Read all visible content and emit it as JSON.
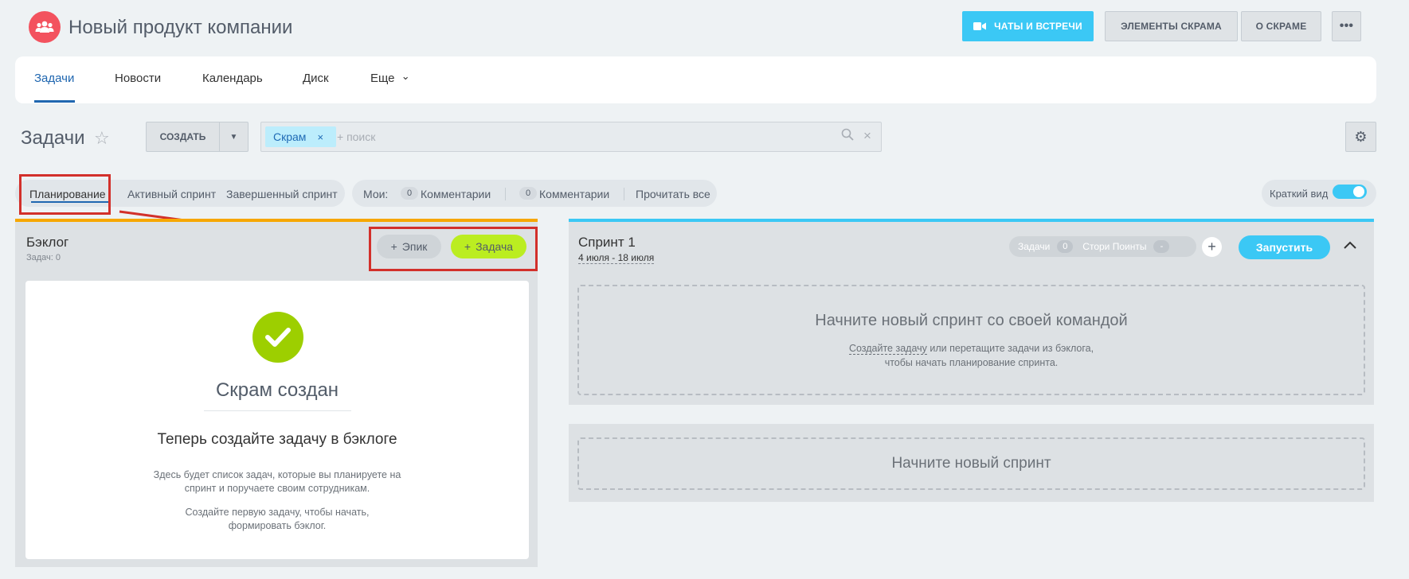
{
  "header": {
    "title": "Новый продукт компании",
    "buttons": {
      "chats": "ЧАТЫ И ВСТРЕЧИ",
      "elements": "ЭЛЕМЕНТЫ СКРАМА",
      "about": "О СКРАМЕ",
      "more": "•••"
    }
  },
  "nav": {
    "tabs": [
      {
        "label": "Задачи",
        "active": true
      },
      {
        "label": "Новости"
      },
      {
        "label": "Календарь"
      },
      {
        "label": "Диск"
      },
      {
        "label": "Еще"
      }
    ],
    "more_chevron": "⌄"
  },
  "toolbar": {
    "title": "Задачи",
    "star": "☆",
    "create_label": "СОЗДАТЬ",
    "create_arrow": "▼",
    "search": {
      "tag": "Скрам",
      "tag_close": "×",
      "placeholder": "+ поиск",
      "search_glyph": "⌕",
      "clear_glyph": "×"
    },
    "settings_glyph": "⚙"
  },
  "views": {
    "tabs": [
      "Планирование",
      "Активный спринт",
      "Завершенный спринт"
    ],
    "mine_label": "Мои:",
    "counter_1": "0",
    "comments_1": "Комментарии",
    "counter_2": "0",
    "comments_2": "Комментарии",
    "read_all": "Прочитать все",
    "compact_label": "Краткий вид",
    "compact_on": true
  },
  "backlog": {
    "title": "Бэклог",
    "subtitle": "Задач: 0",
    "epic_button": "Эпик",
    "task_button": "Задача",
    "plus": "+",
    "card": {
      "title": "Скрам создан",
      "subtitle": "Теперь создайте задачу в бэклоге",
      "text_1_line1": "Здесь будет список задач, которые вы планируете на",
      "text_1_line2": "спринт и поручаете своим сотрудникам.",
      "text_2_line1": "Создайте первую задачу, чтобы начать,",
      "text_2_line2": "формировать бэклог."
    }
  },
  "sprint": {
    "title": "Спринт 1",
    "dates": "4 июля - 18 июля",
    "stats": {
      "tasks_label": "Задачи",
      "tasks_count": "0",
      "points_label": "Стори Поинты",
      "points_value": "-"
    },
    "add": "+",
    "start_button": "Запустить",
    "collapse": "⌃",
    "drop": {
      "title": "Начните новый спринт со своей командой",
      "link": "Создайте задачу",
      "text_1_rest": " или перетащите задачи из бэклога,",
      "text_2": "чтобы начать планирование спринта."
    }
  },
  "new_sprint": {
    "label": "Начните новый спринт"
  },
  "colors": {
    "accent_blue": "#3bc8f5",
    "link_blue": "#2067b0",
    "backlog_border": "#f7a700",
    "task_green": "#bbed21",
    "check_green": "#9dcf00",
    "annotation_red": "#d2302b"
  }
}
